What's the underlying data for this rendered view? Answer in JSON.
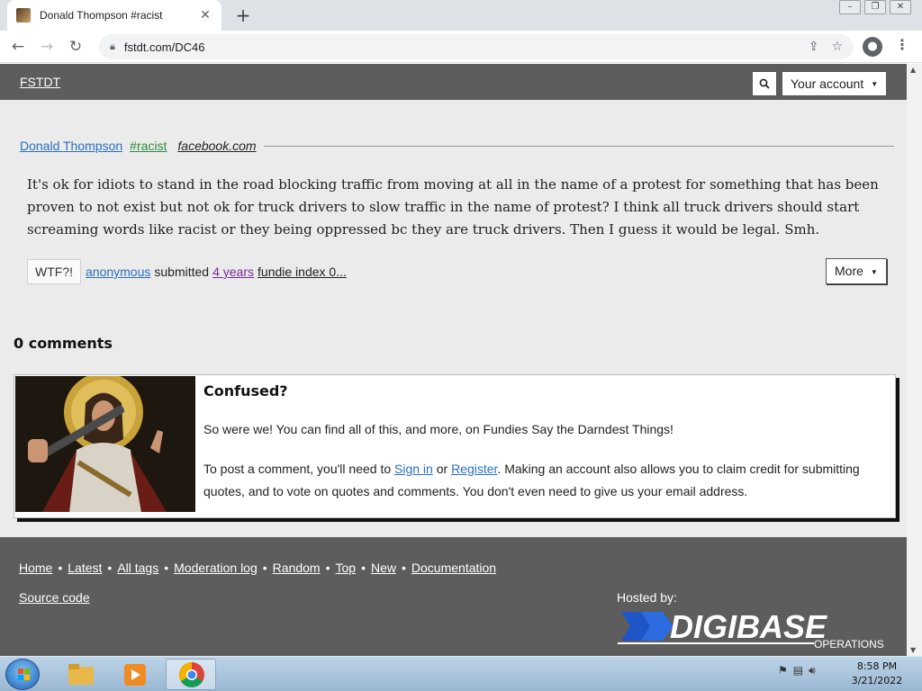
{
  "browser": {
    "tab_title": "Donald Thompson #racist",
    "tab_close": "✕",
    "new_tab": "+",
    "url": "fstdt.com/DC46",
    "window_controls": [
      "–",
      "❐",
      "✕"
    ]
  },
  "site": {
    "brand": "FSTDT",
    "account_label": "Your account",
    "caret": "▼"
  },
  "quote": {
    "author": "Donald Thompson",
    "tag": "#racist",
    "source": "facebook.com",
    "text": "It's ok for idiots to stand in the road blocking traffic from moving at all in the name of a protest for something that has been proven to not exist but not ok for truck drivers to slow traffic in the name of protest? I think all truck drivers should start screaming words like racist or they being oppressed bc they are truck drivers. Then I guess it would be legal. Smh."
  },
  "meta": {
    "wtf_label": "WTF?!",
    "submitter": "anonymous",
    "submitted_word": "submitted",
    "age": "4 years",
    "fundie_index": "fundie index 0...",
    "more_label": "More"
  },
  "comments": {
    "heading": "0 comments"
  },
  "confused": {
    "title": "Confused?",
    "text1": "So were we! You can find all of this, and more, on Fundies Say the Darndest Things!",
    "text2_prefix": "To post a comment, you'll need to ",
    "sign_in": "Sign in",
    "or": " or ",
    "register": "Register",
    "text2_suffix": ". Making an account also allows you to claim credit for submitting quotes, and to vote on quotes and comments. You don't even need to give us your email address."
  },
  "footer": {
    "links": [
      "Home",
      "Latest",
      "All tags",
      "Moderation log",
      "Random",
      "Top",
      "New",
      "Documentation"
    ],
    "separator": "•",
    "source_code": "Source code",
    "hosted_by": "Hosted by:",
    "logo_text": "DIGIBASE",
    "logo_sub": "OPERATIONS"
  },
  "taskbar": {
    "time": "8:58 PM",
    "date": "3/21/2022"
  },
  "colors": {
    "header_bg": "#5d5d5d",
    "link_blue": "#2a6fc0",
    "tag_green": "#2e8b3c",
    "visited_purple": "#7a2a9a",
    "logo_blue": "#1e56c8"
  }
}
